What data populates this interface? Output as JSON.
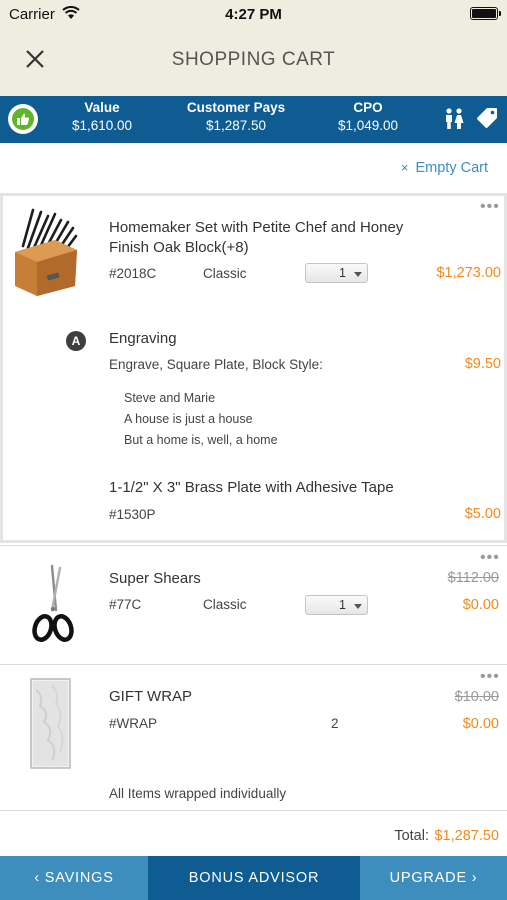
{
  "status_bar": {
    "carrier": "Carrier",
    "time": "4:27 PM"
  },
  "header": {
    "title": "SHOPPING CART"
  },
  "summary": {
    "value_label": "Value",
    "value": "$1,610.00",
    "customer_pays_label": "Customer Pays",
    "customer_pays": "$1,287.50",
    "cpo_label": "CPO",
    "cpo": "$1,049.00"
  },
  "empty_cart": {
    "icon": "×",
    "label": "Empty Cart"
  },
  "items": [
    {
      "name_line1": "Homemaker Set with Petite Chef and Honey",
      "name_line2": "Finish Oak Block(+8)",
      "sku": "#2018C",
      "style": "Classic",
      "qty": "1",
      "price": "$1,273.00"
    },
    {
      "name": "Super Shears",
      "sku": "#77C",
      "style": "Classic",
      "qty": "1",
      "original_price": "$112.00",
      "price": "$0.00"
    },
    {
      "name": "GIFT WRAP",
      "sku": "#WRAP",
      "qty": "2",
      "original_price": "$10.00",
      "price": "$0.00",
      "note": "All Items wrapped individually"
    }
  ],
  "engraving": {
    "badge": "A",
    "title": "Engraving",
    "description": "Engrave, Square Plate, Block Style:",
    "price": "$9.50",
    "lines": [
      "Steve and Marie",
      "A house is just a house",
      "But a home is, well, a home"
    ]
  },
  "addon": {
    "name": "1-1/2\" X 3\" Brass Plate with Adhesive Tape",
    "sku": "#1530P",
    "price": "$5.00"
  },
  "more_icon": "•••",
  "totals": {
    "label": "Total:",
    "amount": "$1,287.50"
  },
  "bottom_nav": {
    "savings": "‹ SAVINGS",
    "bonus": "BONUS ADVISOR",
    "upgrade": "UPGRADE ›"
  },
  "colors": {
    "header_bg": "#efede0",
    "bar_blue": "#0f5c93",
    "nav_blue": "#3e8ebd",
    "price_orange": "#f08a1c",
    "link_blue": "#3d8ec0",
    "thumb_green": "#62b42c"
  }
}
